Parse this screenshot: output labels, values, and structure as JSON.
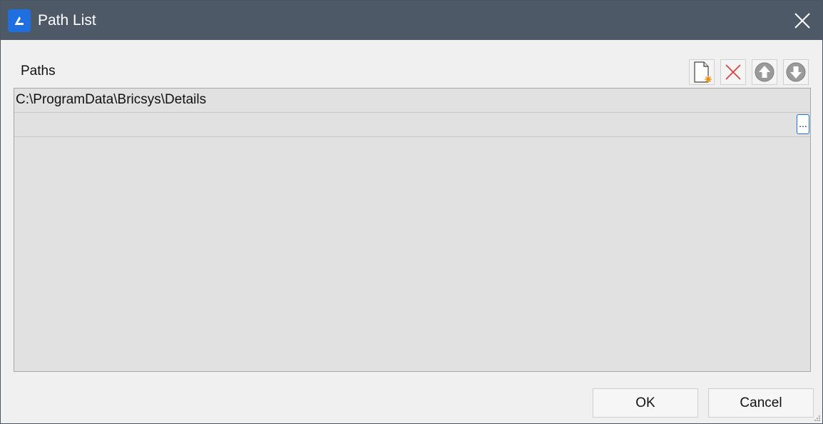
{
  "window": {
    "title": "Path List"
  },
  "paths_section": {
    "label": "Paths",
    "toolbar": {
      "new_icon": "new-document-icon",
      "delete_icon": "delete-x-icon",
      "move_up_icon": "arrow-up-circle-icon",
      "move_down_icon": "arrow-down-circle-icon"
    },
    "rows": [
      {
        "path": "C:\\ProgramData\\Bricsys\\Details"
      },
      {
        "path": ""
      }
    ],
    "browse_label": "..."
  },
  "buttons": {
    "ok_label": "OK",
    "cancel_label": "Cancel"
  },
  "colors": {
    "titlebar": "#4e5968",
    "app_icon": "#1f6fe0",
    "list_background": "#e1e1e1",
    "browse_border": "#1a73d9"
  }
}
